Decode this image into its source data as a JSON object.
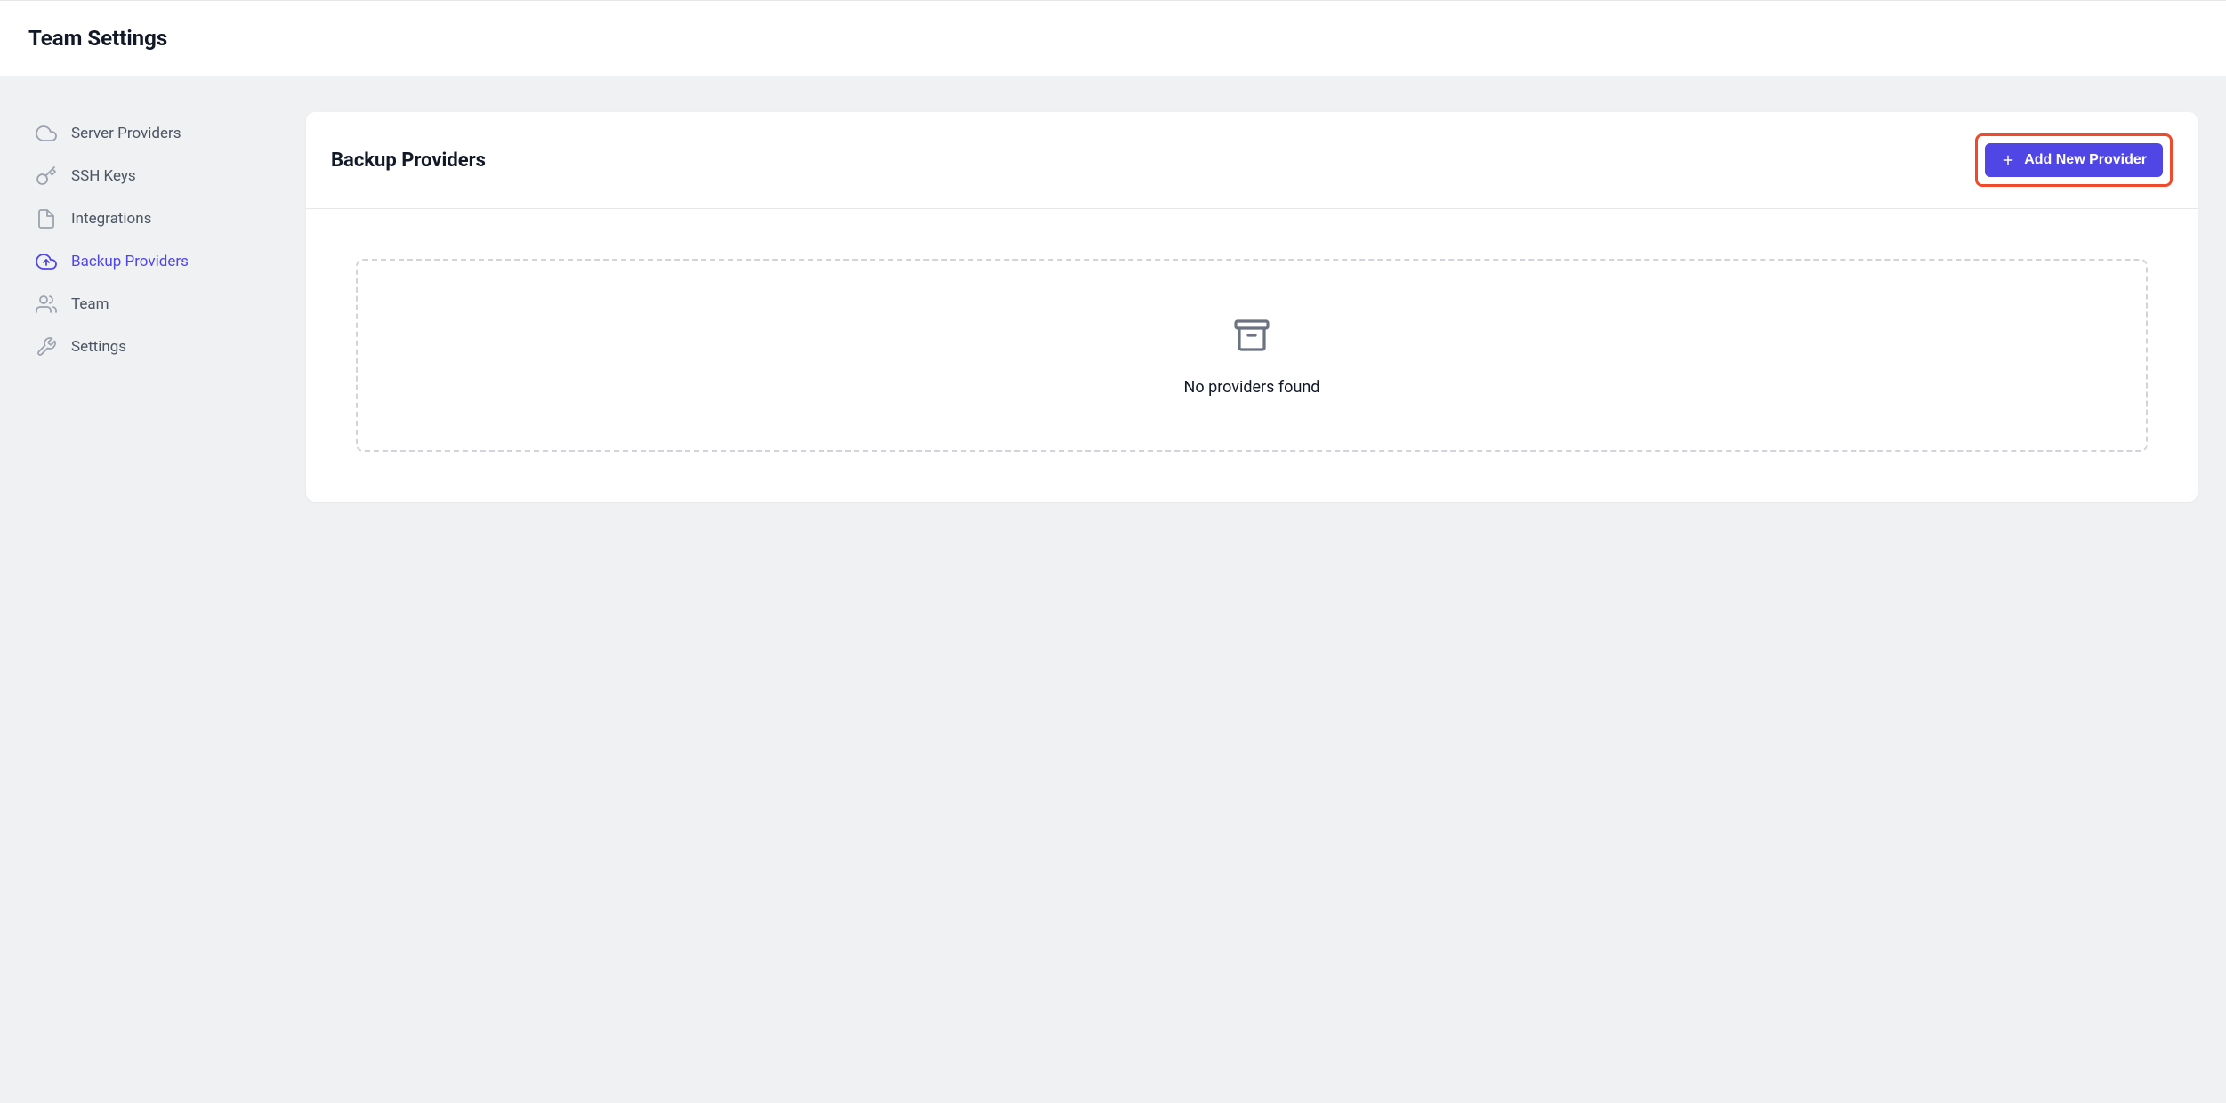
{
  "header": {
    "title": "Team Settings"
  },
  "sidebar": {
    "items": [
      {
        "label": "Server Providers",
        "icon": "cloud-icon",
        "active": false
      },
      {
        "label": "SSH Keys",
        "icon": "key-icon",
        "active": false
      },
      {
        "label": "Integrations",
        "icon": "integrations-icon",
        "active": false
      },
      {
        "label": "Backup Providers",
        "icon": "cloud-upload-icon",
        "active": true
      },
      {
        "label": "Team",
        "icon": "users-icon",
        "active": false
      },
      {
        "label": "Settings",
        "icon": "tools-icon",
        "active": false
      }
    ]
  },
  "content": {
    "title": "Backup Providers",
    "add_button_label": "Add New Provider",
    "empty_state_text": "No providers found"
  },
  "colors": {
    "accent": "#5046e5",
    "highlight_border": "#f04a2c",
    "background": "#f0f1f3",
    "card": "#ffffff",
    "text_muted": "#4b5563",
    "icon_muted": "#9ca3af"
  }
}
